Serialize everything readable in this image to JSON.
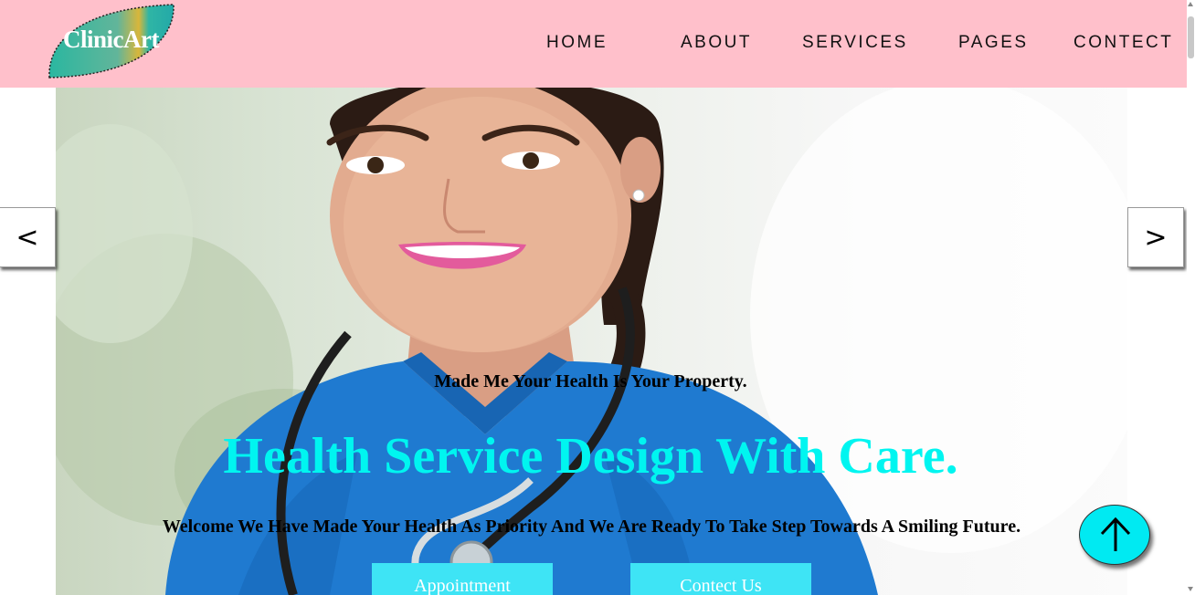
{
  "brand": {
    "name": "ClinicArt"
  },
  "nav": {
    "items": [
      {
        "label": "HOME"
      },
      {
        "label": "ABOUT"
      },
      {
        "label": "SERVICES"
      },
      {
        "label": "PAGES"
      },
      {
        "label": "CONTECT"
      }
    ]
  },
  "slider": {
    "prev_label": "<",
    "next_label": ">"
  },
  "hero": {
    "tagline": "Made Me Your Health Is Your Property.",
    "headline": "Health Service Design With Care.",
    "welcome": "Welcome We Have Made Your Health As Priority And We Are Ready To Take Step Towards A Smiling Future.",
    "appointment_label": "Appointment",
    "contact_label": "Contect Us"
  },
  "colors": {
    "header_bg": "#ffc0cb",
    "headline": "#00f5f0",
    "button_bg": "#3ee4f5",
    "scroll_top_bg": "#00eaf2"
  },
  "icons": {
    "scroll_top": "arrow-up-icon"
  }
}
